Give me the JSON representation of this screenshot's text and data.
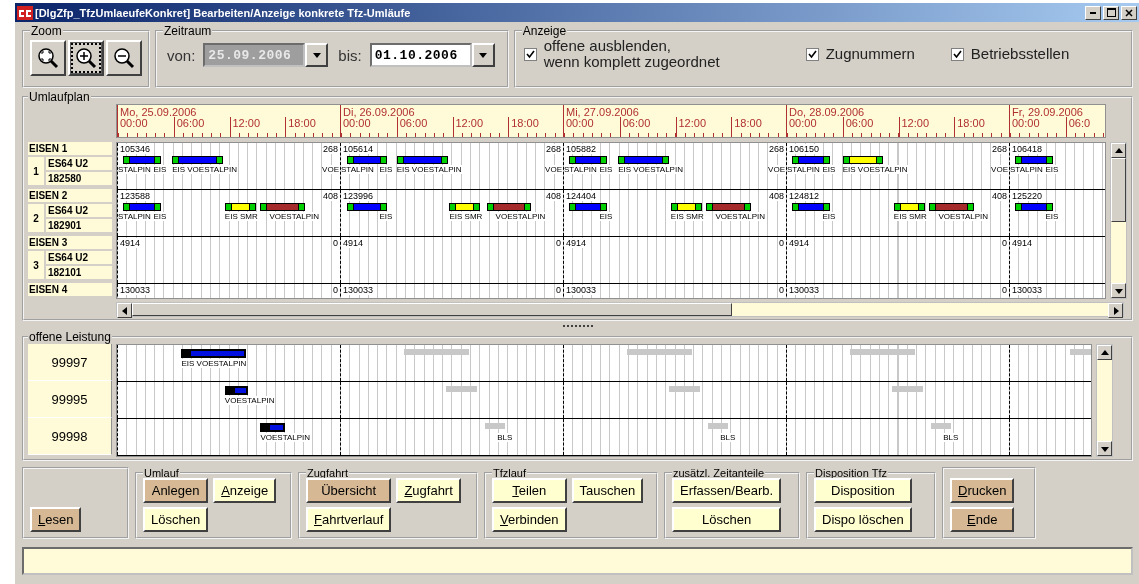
{
  "window": {
    "title": "[DlgZfp_TfzUmlaeufeKonkret] Bearbeiten/Anzeige konkrete Tfz-Umläufe"
  },
  "zoom": {
    "label": "Zoom",
    "buttons": [
      {
        "kind": "fit",
        "focused": false
      },
      {
        "kind": "in",
        "focused": true
      },
      {
        "kind": "out",
        "focused": false
      }
    ]
  },
  "zeitraum": {
    "label": "Zeitraum",
    "fields": [
      {
        "label": "von:",
        "value": "25.09.2006",
        "disabled": true
      },
      {
        "label": "bis:",
        "value": "01.10.2006",
        "disabled": false
      }
    ]
  },
  "anzeige": {
    "label": "Anzeige",
    "options": [
      {
        "label": "offene ausblenden,\nwenn komplett zugeordnet",
        "checked": true
      },
      {
        "label": "Zugnummern",
        "checked": true
      },
      {
        "label": "Betriebsstellen",
        "checked": true
      }
    ]
  },
  "umlaufplan": {
    "label": "Umlaufplan",
    "days": [
      {
        "label": "Mo, 25.09.2006",
        "hours": [
          "00:00",
          "06:00",
          "12:00",
          "18:00"
        ]
      },
      {
        "label": "Di, 26.09.2006",
        "hours": [
          "00:00",
          "06:00",
          "12:00",
          "18:00"
        ]
      },
      {
        "label": "Mi, 27.09.2006",
        "hours": [
          "00:00",
          "06:00",
          "12:00",
          "18:00"
        ]
      },
      {
        "label": "Do, 28.09.2006",
        "hours": [
          "00:00",
          "06:00",
          "12:00",
          "18:00"
        ]
      },
      {
        "label": "Fr, 29.09.2006",
        "hours": [
          "00:00",
          "06:0"
        ]
      }
    ],
    "rows": [
      {
        "name": "EISEN 1",
        "index": "1",
        "type": "ES64 U2",
        "number": "182580",
        "days": [
          {
            "start": "105346",
            "end": "268",
            "carry_in": "STALPIN",
            "carry_out": "VOE",
            "bars": [
              {
                "color": "#0000ff",
                "label": "EIS"
              },
              {
                "color": "#0000ff",
                "label": "EIS VOESTALPIN"
              }
            ]
          },
          {
            "start": "105614",
            "end": "268",
            "carry_in": "STALPIN",
            "carry_out": "VOE",
            "bars": [
              {
                "color": "#0000ff",
                "label": "EIS"
              },
              {
                "color": "#0000ff",
                "label": "EIS VOESTALPIN"
              }
            ]
          },
          {
            "start": "105882",
            "end": "268",
            "carry_in": "STALPIN",
            "carry_out": "VOE",
            "bars": [
              {
                "color": "#0000ff",
                "label": "EIS"
              },
              {
                "color": "#0000ff",
                "label": "EIS VOESTALPIN"
              }
            ]
          },
          {
            "start": "106150",
            "end": "268",
            "carry_in": "STALPIN",
            "carry_out": "VOE",
            "bars": [
              {
                "color": "#0000ff",
                "label": "EIS"
              },
              {
                "color": "#ffff00",
                "label": "EIS VOESTALPIN"
              }
            ]
          },
          {
            "start": "106418",
            "carry_in": "STALPIN",
            "bars": [
              {
                "color": "#0000ff",
                "label": "EIS"
              }
            ]
          }
        ]
      },
      {
        "name": "EISEN 2",
        "index": "2",
        "type": "ES64 U2",
        "number": "182901",
        "days": [
          {
            "start": "123588",
            "end": "408",
            "carry_in": "STALPIN",
            "bars": [
              {
                "color": "#0000ff",
                "label": "EIS"
              },
              {
                "color": "#ffff00",
                "label": "EIS SMR"
              },
              {
                "color": "#a52a2a",
                "label": "VOESTALPIN"
              }
            ]
          },
          {
            "start": "123996",
            "end": "408",
            "bars": [
              {
                "color": "#0000ff",
                "label": "EIS"
              },
              {
                "color": "#ffff00",
                "label": "EIS SMR"
              },
              {
                "color": "#a52a2a",
                "label": "VOESTALPIN"
              }
            ]
          },
          {
            "start": "124404",
            "end": "408",
            "bars": [
              {
                "color": "#0000ff",
                "label": "EIS"
              },
              {
                "color": "#ffff00",
                "label": "EIS SMR"
              },
              {
                "color": "#a52a2a",
                "label": "VOESTALPIN"
              }
            ]
          },
          {
            "start": "124812",
            "end": "408",
            "bars": [
              {
                "color": "#0000ff",
                "label": "EIS"
              },
              {
                "color": "#ffff00",
                "label": "EIS SMR"
              },
              {
                "color": "#a52a2a",
                "label": "VOESTALPIN"
              }
            ]
          },
          {
            "start": "125220",
            "bars": [
              {
                "color": "#0000ff",
                "label": "EIS"
              }
            ]
          }
        ]
      },
      {
        "name": "EISEN 3",
        "index": "3",
        "type": "ES64 U2",
        "number": "182101",
        "days": [
          {
            "start": "4914",
            "end": "0"
          },
          {
            "start": "4914",
            "end": "0"
          },
          {
            "start": "4914",
            "end": "0"
          },
          {
            "start": "4914",
            "end": "0"
          },
          {
            "start": "4914"
          }
        ]
      },
      {
        "name": "EISEN 4",
        "days": [
          {
            "start": "130033",
            "end": "0"
          },
          {
            "start": "130033",
            "end": "0"
          },
          {
            "start": "130033",
            "end": "0"
          },
          {
            "start": "130033",
            "end": "0"
          },
          {
            "start": "130033"
          }
        ]
      }
    ]
  },
  "offene": {
    "label": "offene Leistung",
    "rows": [
      {
        "name": "99997",
        "days": [
          {
            "bars": [
              {
                "kind": "active",
                "label": "EIS VOESTALPIN"
              }
            ]
          },
          {
            "bars": [
              {
                "kind": "shadow"
              }
            ]
          },
          {
            "bars": [
              {
                "kind": "shadow"
              }
            ]
          },
          {
            "bars": [
              {
                "kind": "shadow"
              }
            ]
          },
          {
            "bars": [
              {
                "kind": "shadow"
              }
            ]
          }
        ]
      },
      {
        "name": "99995",
        "days": [
          {
            "bars": [
              {
                "kind": "active",
                "label": "VOESTALPIN"
              }
            ]
          },
          {
            "bars": [
              {
                "kind": "shadow"
              }
            ]
          },
          {
            "bars": [
              {
                "kind": "shadow"
              }
            ]
          },
          {
            "bars": [
              {
                "kind": "shadow"
              }
            ]
          }
        ]
      },
      {
        "name": "99998",
        "days": [
          {
            "bars": [
              {
                "kind": "active",
                "label": "VOESTALPIN"
              }
            ]
          },
          {
            "bars": [
              {
                "kind": "shadow",
                "label": "BLS"
              }
            ]
          },
          {
            "bars": [
              {
                "kind": "shadow",
                "label": "BLS"
              }
            ]
          },
          {
            "bars": [
              {
                "kind": "shadow",
                "label": "BLS"
              }
            ]
          }
        ]
      }
    ]
  },
  "actions": [
    {
      "rows": [
        [
          {
            "label": "Lesen",
            "highlighted": true,
            "mnemonic": true
          }
        ]
      ]
    },
    {
      "label": "Umlauf",
      "rows": [
        [
          {
            "label": "Anlegen",
            "highlighted": true,
            "mnemonic": false
          },
          {
            "label": "Anzeige",
            "highlighted": false,
            "mnemonic": true
          }
        ],
        [
          {
            "label": "Löschen",
            "highlighted": false,
            "mnemonic": false
          }
        ]
      ]
    },
    {
      "label": "Zugfahrt",
      "rows": [
        [
          {
            "label": "Übersicht",
            "highlighted": true,
            "mnemonic": false
          },
          {
            "label": "Zugfahrt",
            "highlighted": false,
            "mnemonic": true
          }
        ],
        [
          {
            "label": "Fahrtverlauf",
            "highlighted": false,
            "mnemonic": true
          }
        ]
      ]
    },
    {
      "label": "Tfzlauf",
      "rows": [
        [
          {
            "label": "Teilen",
            "highlighted": false,
            "mnemonic": true
          },
          {
            "label": "Tauschen",
            "highlighted": false,
            "mnemonic": false
          }
        ],
        [
          {
            "label": "Verbinden",
            "highlighted": false,
            "mnemonic": true
          }
        ]
      ]
    },
    {
      "label": "zusätzl. Zeitanteile",
      "rows": [
        [
          {
            "label": "Erfassen/Bearb.",
            "highlighted": false,
            "mnemonic": false
          }
        ],
        [
          {
            "label": "Löschen",
            "highlighted": false,
            "mnemonic": false
          }
        ]
      ]
    },
    {
      "label": "Disposition Tfz",
      "rows": [
        [
          {
            "label": "Disposition",
            "highlighted": false,
            "mnemonic": false
          }
        ],
        [
          {
            "label": "Dispo löschen",
            "highlighted": false,
            "mnemonic": false
          }
        ]
      ]
    },
    {
      "rows": [
        [
          {
            "label": "Drucken",
            "highlighted": true,
            "mnemonic": true
          }
        ],
        [
          {
            "label": "Ende",
            "highlighted": true,
            "mnemonic": true
          }
        ]
      ]
    }
  ]
}
